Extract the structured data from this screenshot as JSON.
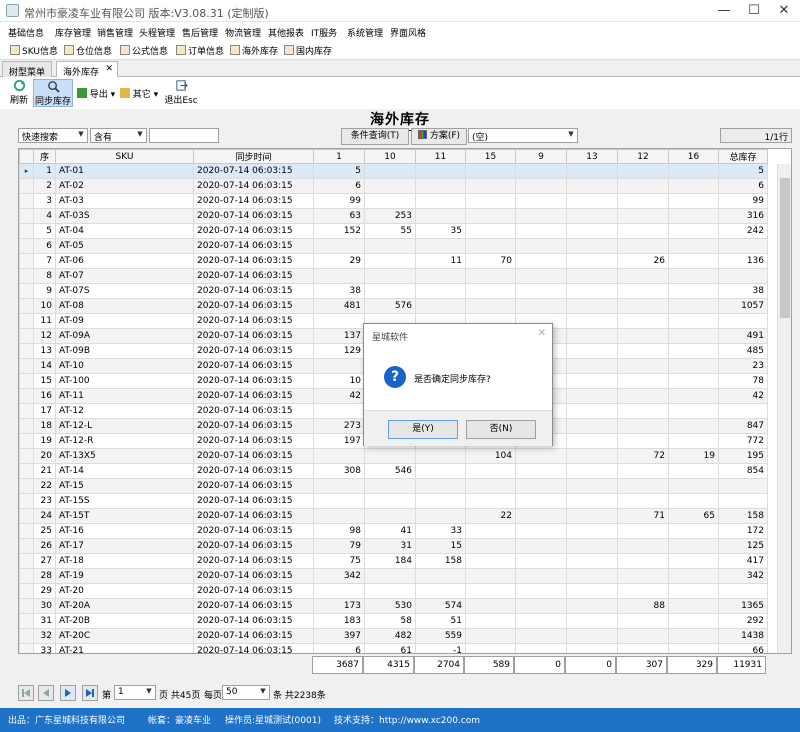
{
  "window": {
    "title": "常州市豪凌车业有限公司  版本:V3.08.31 (定制版)"
  },
  "menu": [
    "基础信息",
    "库存管理",
    "销售管理",
    "头程管理",
    "售后管理",
    "物流管理",
    "其他报表",
    "IT服务",
    "系统管理",
    "界面风格"
  ],
  "quicklinks": [
    "SKU信息",
    "仓位信息",
    "公式信息",
    "订单信息",
    "海外库存",
    "国内库存"
  ],
  "tabs": [
    {
      "label": "树型菜单"
    },
    {
      "label": "海外库存"
    }
  ],
  "toolbar": {
    "refresh": "刷新",
    "sync": "同步库存",
    "export": "导出",
    "other": "其它",
    "exit": "退出Esc"
  },
  "page": {
    "heading": "海外库存"
  },
  "filter": {
    "mode": "快速搜索",
    "op": "含有",
    "value": "",
    "query_btn": "条件查询(T)",
    "plan_btn": "方案(F)",
    "plan_value": "(空)",
    "row_indicator": "1/1行"
  },
  "table": {
    "columns": [
      "序",
      "SKU",
      "同步时间",
      "1",
      "10",
      "11",
      "15",
      "9",
      "13",
      "12",
      "16",
      "总库存"
    ],
    "rows": [
      [
        "1",
        "AT-01",
        "2020-07-14 06:03:15",
        "5",
        "",
        "",
        "",
        "",
        "",
        "",
        "",
        "5"
      ],
      [
        "2",
        "AT-02",
        "2020-07-14 06:03:15",
        "6",
        "",
        "",
        "",
        "",
        "",
        "",
        "",
        "6"
      ],
      [
        "3",
        "AT-03",
        "2020-07-14 06:03:15",
        "99",
        "",
        "",
        "",
        "",
        "",
        "",
        "",
        "99"
      ],
      [
        "4",
        "AT-03S",
        "2020-07-14 06:03:15",
        "63",
        "253",
        "",
        "",
        "",
        "",
        "",
        "",
        "316"
      ],
      [
        "5",
        "AT-04",
        "2020-07-14 06:03:15",
        "152",
        "55",
        "35",
        "",
        "",
        "",
        "",
        "",
        "242"
      ],
      [
        "6",
        "AT-05",
        "2020-07-14 06:03:15",
        "",
        "",
        "",
        "",
        "",
        "",
        "",
        "",
        ""
      ],
      [
        "7",
        "AT-06",
        "2020-07-14 06:03:15",
        "29",
        "",
        "11",
        "70",
        "",
        "",
        "26",
        "",
        "136"
      ],
      [
        "8",
        "AT-07",
        "2020-07-14 06:03:15",
        "",
        "",
        "",
        "",
        "",
        "",
        "",
        "",
        ""
      ],
      [
        "9",
        "AT-07S",
        "2020-07-14 06:03:15",
        "38",
        "",
        "",
        "",
        "",
        "",
        "",
        "",
        "38"
      ],
      [
        "10",
        "AT-08",
        "2020-07-14 06:03:15",
        "481",
        "576",
        "",
        "",
        "",
        "",
        "",
        "",
        "1057"
      ],
      [
        "11",
        "AT-09",
        "2020-07-14 06:03:15",
        "",
        "",
        "",
        "",
        "",
        "",
        "",
        "",
        ""
      ],
      [
        "12",
        "AT-09A",
        "2020-07-14 06:03:15",
        "137",
        "",
        "",
        "",
        "",
        "",
        "",
        "",
        "491"
      ],
      [
        "13",
        "AT-09B",
        "2020-07-14 06:03:15",
        "129",
        "",
        "",
        "",
        "",
        "",
        "",
        "",
        "485"
      ],
      [
        "14",
        "AT-10",
        "2020-07-14 06:03:15",
        "",
        "",
        "",
        "",
        "",
        "",
        "",
        "",
        "23"
      ],
      [
        "15",
        "AT-100",
        "2020-07-14 06:03:15",
        "10",
        "",
        "",
        "",
        "",
        "",
        "",
        "",
        "78"
      ],
      [
        "16",
        "AT-11",
        "2020-07-14 06:03:15",
        "42",
        "",
        "",
        "",
        "",
        "",
        "",
        "",
        "42"
      ],
      [
        "17",
        "AT-12",
        "2020-07-14 06:03:15",
        "",
        "",
        "",
        "",
        "",
        "",
        "",
        "",
        ""
      ],
      [
        "18",
        "AT-12-L",
        "2020-07-14 06:03:15",
        "273",
        "",
        "",
        "",
        "",
        "",
        "",
        "",
        "847"
      ],
      [
        "19",
        "AT-12-R",
        "2020-07-14 06:03:15",
        "197",
        "",
        "",
        "",
        "",
        "",
        "",
        "",
        "772"
      ],
      [
        "20",
        "AT-13X5",
        "2020-07-14 06:03:15",
        "",
        "",
        "",
        "104",
        "",
        "",
        "72",
        "19",
        "195"
      ],
      [
        "21",
        "AT-14",
        "2020-07-14 06:03:15",
        "308",
        "546",
        "",
        "",
        "",
        "",
        "",
        "",
        "854"
      ],
      [
        "22",
        "AT-15",
        "2020-07-14 06:03:15",
        "",
        "",
        "",
        "",
        "",
        "",
        "",
        "",
        ""
      ],
      [
        "23",
        "AT-15S",
        "2020-07-14 06:03:15",
        "",
        "",
        "",
        "",
        "",
        "",
        "",
        "",
        ""
      ],
      [
        "24",
        "AT-15T",
        "2020-07-14 06:03:15",
        "",
        "",
        "",
        "22",
        "",
        "",
        "71",
        "65",
        "158"
      ],
      [
        "25",
        "AT-16",
        "2020-07-14 06:03:15",
        "98",
        "41",
        "33",
        "",
        "",
        "",
        "",
        "",
        "172"
      ],
      [
        "26",
        "AT-17",
        "2020-07-14 06:03:15",
        "79",
        "31",
        "15",
        "",
        "",
        "",
        "",
        "",
        "125"
      ],
      [
        "27",
        "AT-18",
        "2020-07-14 06:03:15",
        "75",
        "184",
        "158",
        "",
        "",
        "",
        "",
        "",
        "417"
      ],
      [
        "28",
        "AT-19",
        "2020-07-14 06:03:15",
        "342",
        "",
        "",
        "",
        "",
        "",
        "",
        "",
        "342"
      ],
      [
        "29",
        "AT-20",
        "2020-07-14 06:03:15",
        "",
        "",
        "",
        "",
        "",
        "",
        "",
        "",
        ""
      ],
      [
        "30",
        "AT-20A",
        "2020-07-14 06:03:15",
        "173",
        "530",
        "574",
        "",
        "",
        "",
        "88",
        "",
        "1365"
      ],
      [
        "31",
        "AT-20B",
        "2020-07-14 06:03:15",
        "183",
        "58",
        "51",
        "",
        "",
        "",
        "",
        "",
        "292"
      ],
      [
        "32",
        "AT-20C",
        "2020-07-14 06:03:15",
        "397",
        "482",
        "559",
        "",
        "",
        "",
        "",
        "",
        "1438"
      ],
      [
        "33",
        "AT-21",
        "2020-07-14 06:03:15",
        "6",
        "61",
        "-1",
        "",
        "",
        "",
        "",
        "",
        "66"
      ]
    ],
    "totals": [
      "3687",
      "4315",
      "2704",
      "589",
      "0",
      "0",
      "307",
      "329",
      "11931"
    ]
  },
  "pager": {
    "page_label": "第",
    "page_value": "1",
    "total_pages": "页 共45页",
    "per_page_label": "每页",
    "per_page_value": "50",
    "total_items": "条 共2238条"
  },
  "status": {
    "vendor": "出品：广东星城科技有限公司",
    "account": "帐套：豪凌车业",
    "operator": "操作员:星城测试(0001)",
    "support": "技术支持：http://www.xc200.com"
  },
  "dialog": {
    "title": "星城软件",
    "message": "是否确定同步库存?",
    "yes": "是(Y)",
    "no": "否(N)"
  },
  "colors": {
    "status_bar": "#1e72c8",
    "dialog_icon": "#1a64c8",
    "selected_row": "#dce9f7"
  }
}
